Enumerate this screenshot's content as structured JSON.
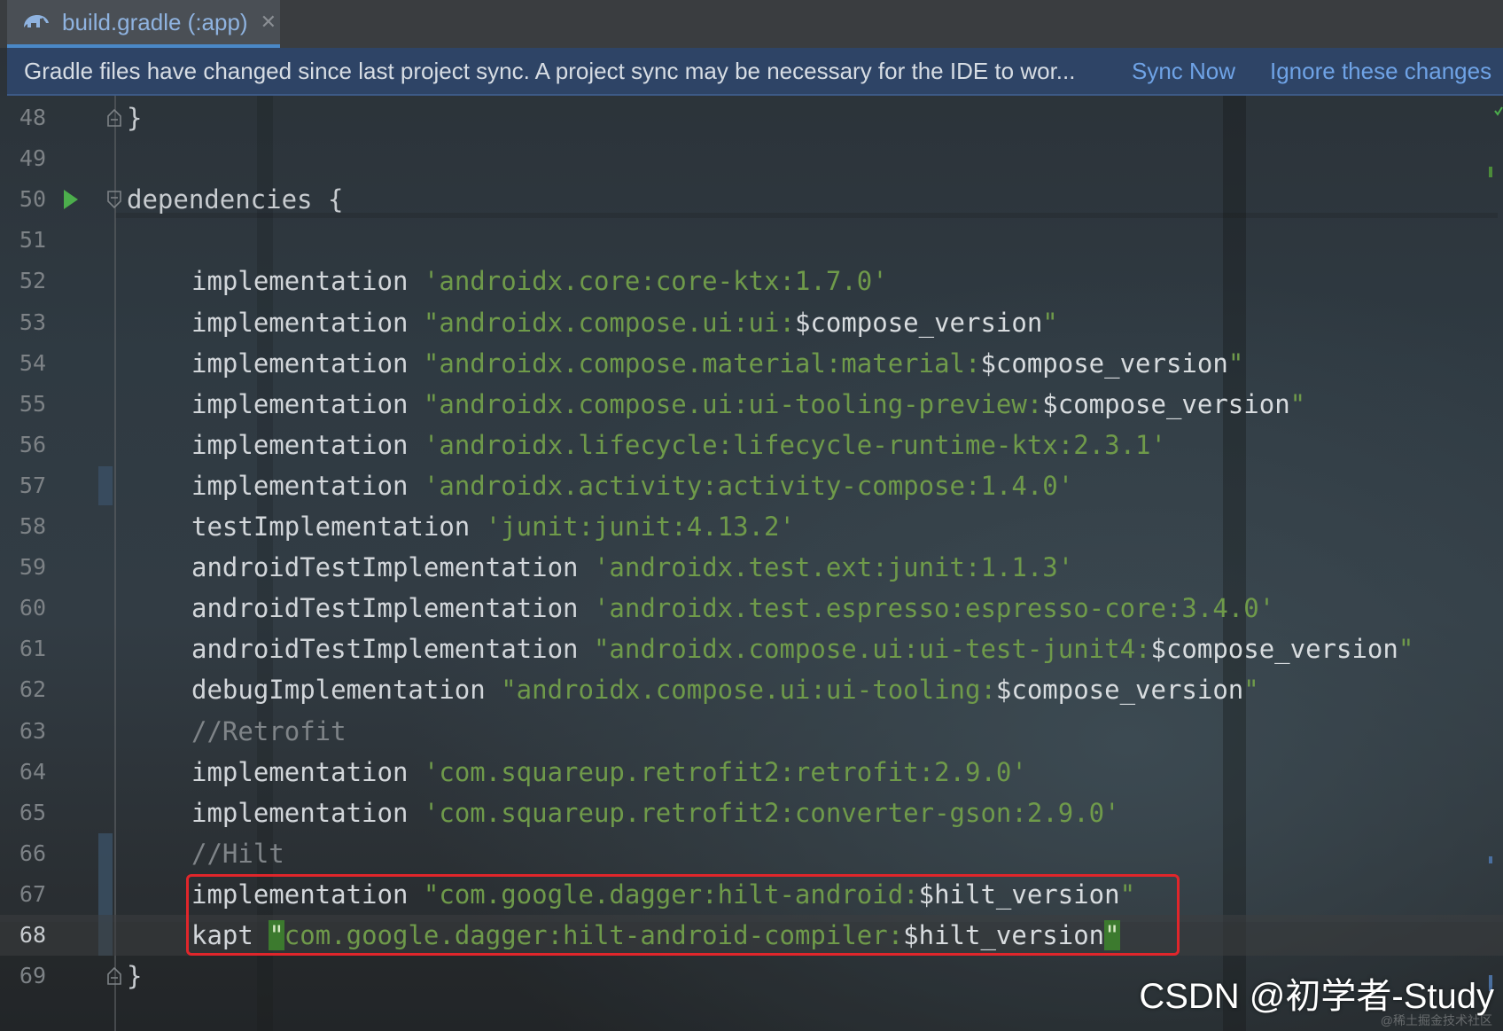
{
  "tab": {
    "icon": "gradle-elephant-icon",
    "label": "build.gradle (:app)",
    "close_glyph": "✕"
  },
  "notification": {
    "message": "Gradle files have changed since last project sync. A project sync may be necessary for the IDE to wor...",
    "sync_now": "Sync Now",
    "ignore": "Ignore these changes"
  },
  "editor": {
    "current_line": 68,
    "lines": [
      {
        "n": "48",
        "code": "}"
      },
      {
        "n": "49",
        "code": ""
      },
      {
        "n": "50",
        "code": "dependencies {"
      },
      {
        "n": "51",
        "code": ""
      },
      {
        "n": "52",
        "kw": "implementation",
        "str": "'androidx.core:core-ktx:1.7.0'"
      },
      {
        "n": "53",
        "kw": "implementation",
        "str": "\"androidx.compose.ui:ui:",
        "tpl": "$compose_version",
        "end": "\""
      },
      {
        "n": "54",
        "kw": "implementation",
        "str": "\"androidx.compose.material:material:",
        "tpl": "$compose_version",
        "end": "\""
      },
      {
        "n": "55",
        "kw": "implementation",
        "str": "\"androidx.compose.ui:ui-tooling-preview:",
        "tpl": "$compose_version",
        "end": "\""
      },
      {
        "n": "56",
        "kw": "implementation",
        "str": "'androidx.lifecycle:lifecycle-runtime-ktx:2.3.1'"
      },
      {
        "n": "57",
        "kw": "implementation",
        "str": "'androidx.activity:activity-compose:1.4.0'"
      },
      {
        "n": "58",
        "kw": "testImplementation",
        "str": "'junit:junit:4.13.2'"
      },
      {
        "n": "59",
        "kw": "androidTestImplementation",
        "str": "'androidx.test.ext:junit:1.1.3'"
      },
      {
        "n": "60",
        "kw": "androidTestImplementation",
        "str": "'androidx.test.espresso:espresso-core:3.4.0'"
      },
      {
        "n": "61",
        "kw": "androidTestImplementation",
        "str": "\"androidx.compose.ui:ui-test-junit4:",
        "tpl": "$compose_version",
        "end": "\""
      },
      {
        "n": "62",
        "kw": "debugImplementation",
        "str": "\"androidx.compose.ui:ui-tooling:",
        "tpl": "$compose_version",
        "end": "\""
      },
      {
        "n": "63",
        "comment": "//Retrofit"
      },
      {
        "n": "64",
        "kw": "implementation",
        "str": "'com.squareup.retrofit2:retrofit:2.9.0'"
      },
      {
        "n": "65",
        "kw": "implementation",
        "str": "'com.squareup.retrofit2:converter-gson:2.9.0'"
      },
      {
        "n": "66",
        "comment": "//Hilt"
      },
      {
        "n": "67",
        "kw": "implementation",
        "str": "\"com.google.dagger:hilt-android:",
        "tpl": "$hilt_version",
        "end": "\""
      },
      {
        "n": "68",
        "kw": "kapt",
        "open": "\"",
        "str": "com.google.dagger:hilt-android-compiler:",
        "tpl": "$hilt_version",
        "end_hl": "\""
      },
      {
        "n": "69",
        "code": "}"
      }
    ]
  },
  "watermark": {
    "text": "CSDN @初学者-Study",
    "sub": "@稀土掘金技术社区"
  }
}
